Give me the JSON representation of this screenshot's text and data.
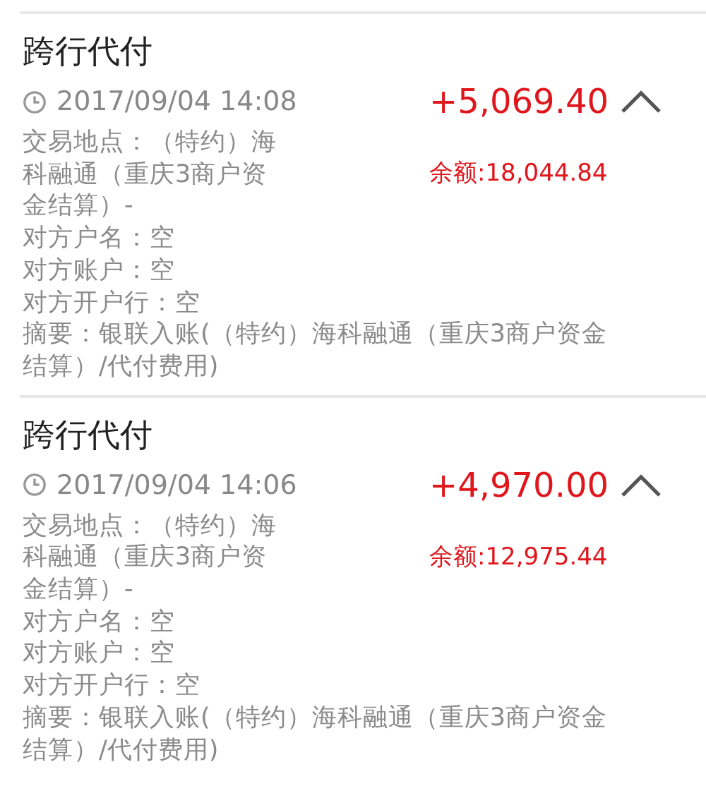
{
  "transactions": [
    {
      "title": "跨行代付",
      "time": "2017/09/04 14:08",
      "amount": "+5,069.40",
      "balance": "余额:18,044.84",
      "expanded": true,
      "location": "交易地点：（特约）海科融通（重庆3商户资金结算）-",
      "details": [
        "对方户名：空",
        "对方账户：空",
        "对方开户行：空"
      ],
      "summary": "摘要：银联入账(（特约）海科融通（重庆3商户资金结算）/代付费用)"
    },
    {
      "title": "跨行代付",
      "time": "2017/09/04 14:06",
      "amount": "+4,970.00",
      "balance": "余额:12,975.44",
      "expanded": true,
      "location": "交易地点：（特约）海科融通（重庆3商户资金结算）-",
      "details": [
        "对方户名：空",
        "对方账户：空",
        "对方开户行：空"
      ],
      "summary": "摘要：银联入账(（特约）海科融通（重庆3商户资金结算）/代付费用)"
    }
  ]
}
